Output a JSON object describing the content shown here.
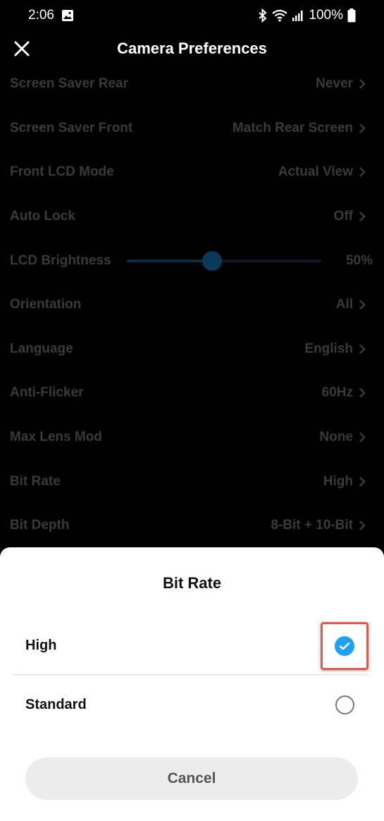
{
  "status_bar": {
    "time": "2:06",
    "battery": "100%",
    "icons": [
      "image-icon",
      "bluetooth-icon",
      "wifi-icon",
      "signal-icon",
      "battery-icon"
    ]
  },
  "header": {
    "title": "Camera Preferences",
    "close_icon": "close-icon"
  },
  "settings": [
    {
      "label": "Screen Saver Rear",
      "value": "Never"
    },
    {
      "label": "Screen Saver Front",
      "value": "Match Rear Screen"
    },
    {
      "label": "Front LCD Mode",
      "value": "Actual View"
    },
    {
      "label": "Auto Lock",
      "value": "Off"
    },
    {
      "label": "LCD Brightness",
      "value": "50%",
      "level": 0.44
    },
    {
      "label": "Orientation",
      "value": "All"
    },
    {
      "label": "Language",
      "value": "English"
    },
    {
      "label": "Anti-Flicker",
      "value": "60Hz"
    },
    {
      "label": "Max Lens Mod",
      "value": "None"
    },
    {
      "label": "Bit Rate",
      "value": "High"
    },
    {
      "label": "Bit Depth",
      "value": "8-Bit + 10-Bit"
    }
  ],
  "sheet": {
    "title": "Bit Rate",
    "options": [
      {
        "label": "High",
        "selected": true
      },
      {
        "label": "Standard",
        "selected": false
      }
    ],
    "cancel_label": "Cancel"
  },
  "colors": {
    "accent": "#1da1f2",
    "highlight_border": "#e05a4f",
    "background": "#000000"
  }
}
